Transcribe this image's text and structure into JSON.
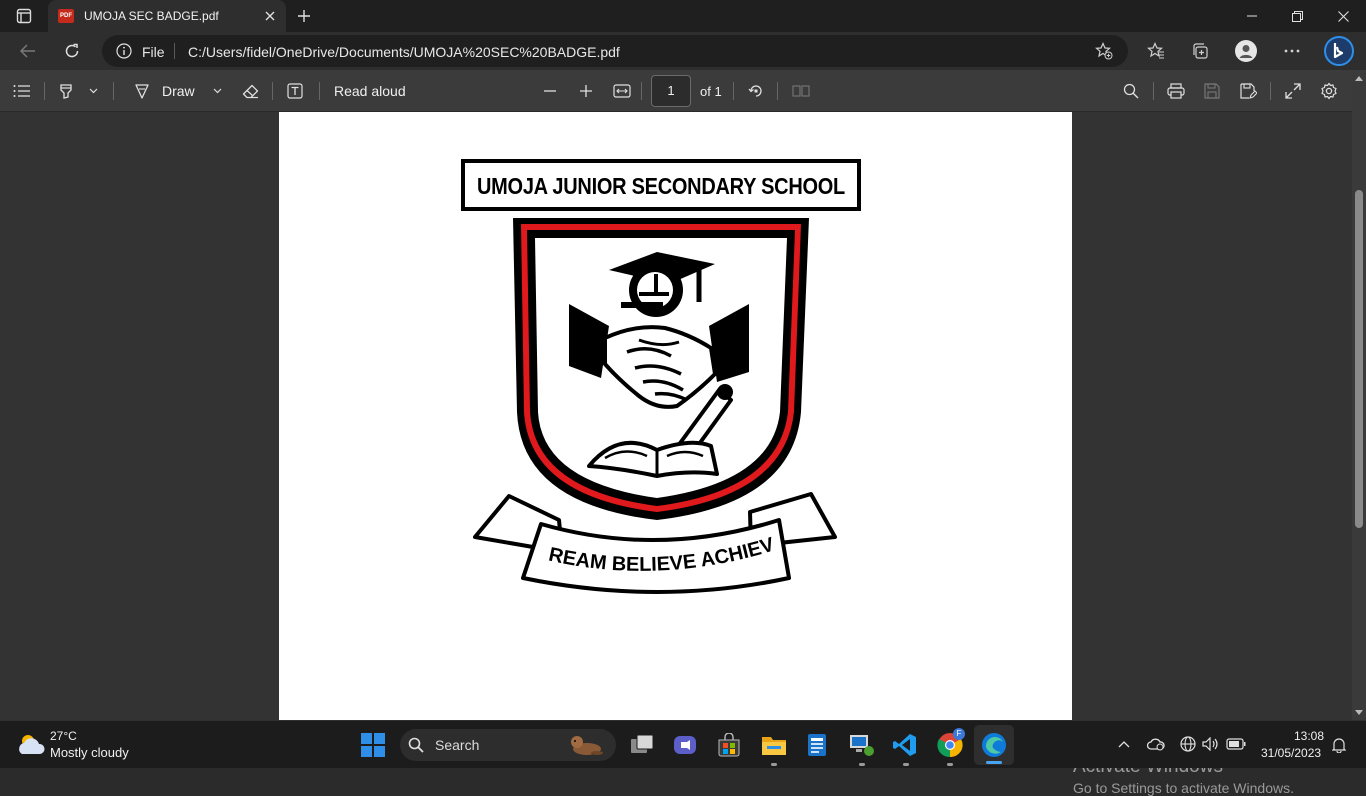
{
  "browser": {
    "tab_title": "UMOJA SEC BADGE.pdf",
    "pdf_badge": "PDF",
    "file_label": "File",
    "url": "C:/Users/fidel/OneDrive/Documents/UMOJA%20SEC%20BADGE.pdf"
  },
  "pdf_toolbar": {
    "draw_label": "Draw",
    "read_aloud_label": "Read aloud",
    "page_number": "1",
    "page_total": "of 1"
  },
  "document": {
    "school_name": "UMOJA JUNIOR SECONDARY SCHOOL",
    "motto": "DREAM BELIEVE ACHIEVE"
  },
  "watermark": {
    "line1": "Activate Windows",
    "line2": "Go to Settings to activate Windows."
  },
  "taskbar": {
    "weather_temp": "27°C",
    "weather_desc": "Mostly cloudy",
    "search_label": "Search",
    "time": "13:08",
    "date": "31/05/2023",
    "chrome_badge": "F"
  },
  "colors": {
    "accent_red": "#e0191d",
    "edge_blue": "#0f7bd8",
    "windows_blue": "#2f8fe8"
  }
}
